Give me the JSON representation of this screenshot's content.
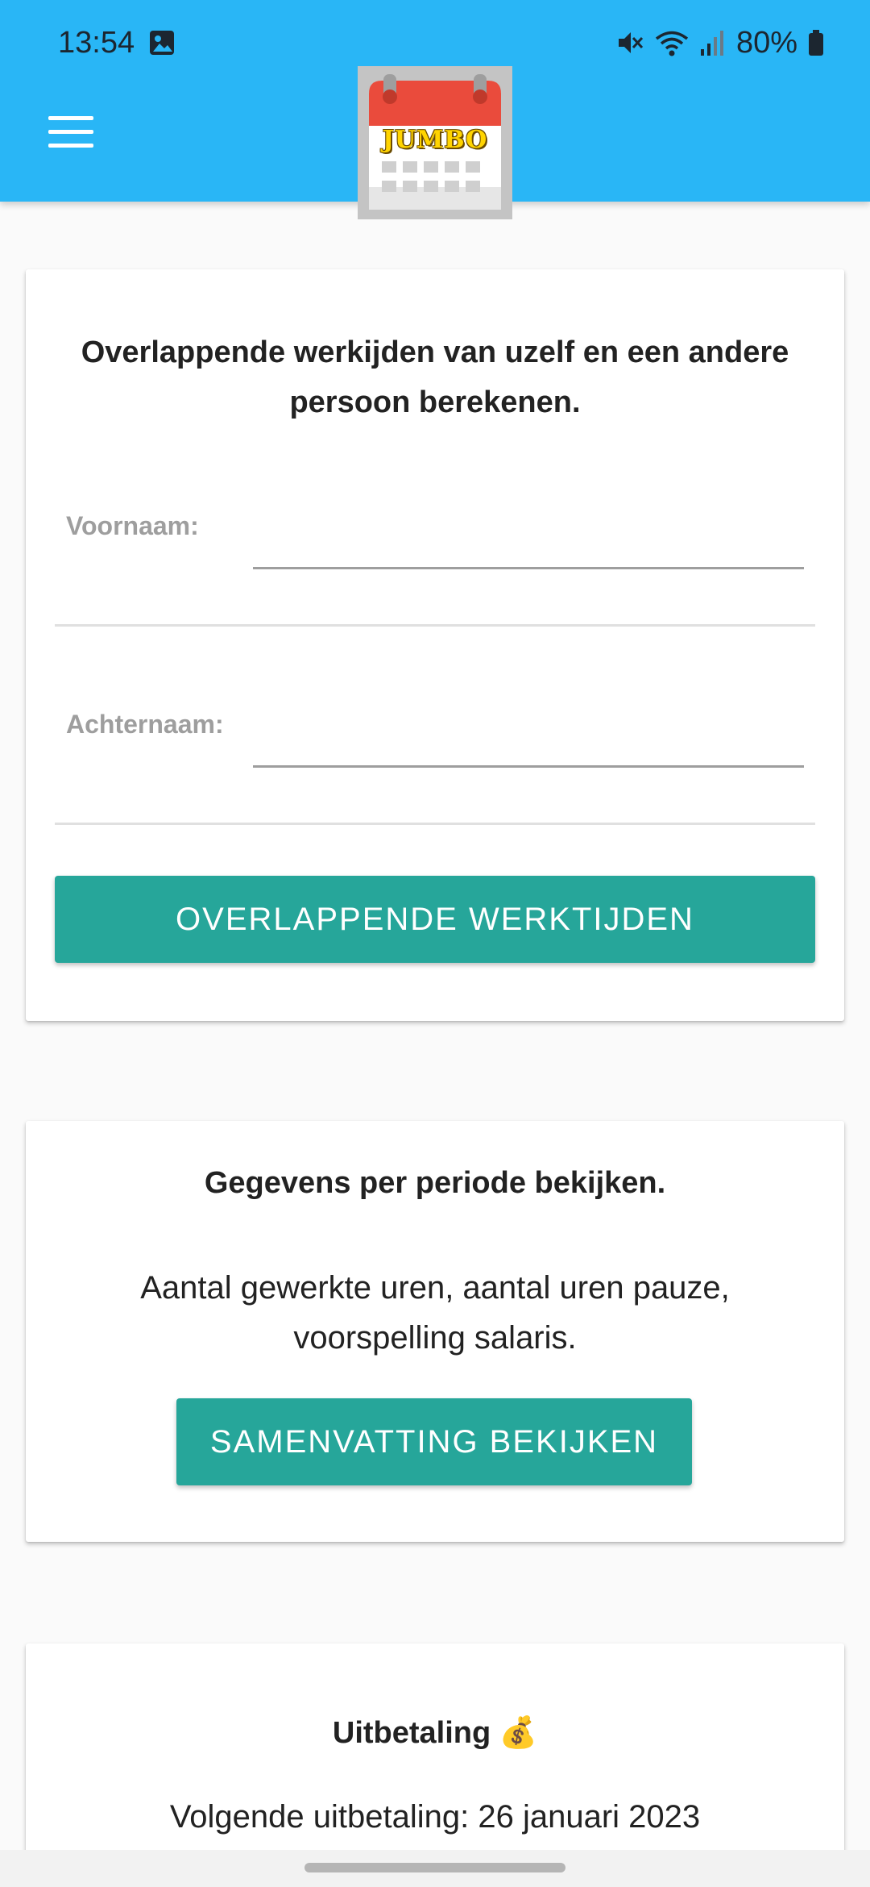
{
  "status_bar": {
    "time": "13:54",
    "battery": "80%"
  },
  "header": {
    "logo_text": "JUMBO",
    "color": "#29b6f6"
  },
  "overlap_card": {
    "title": "Overlappende werkijden van uzelf en een andere persoon berekenen.",
    "first_name_label": "Voornaam:",
    "first_name_value": "",
    "last_name_label": "Achternaam:",
    "last_name_value": "",
    "button_label": "OVERLAPPENDE WERKTIJDEN"
  },
  "summary_card": {
    "title": "Gegevens per periode bekijken.",
    "text": "Aantal gewerkte uren, aantal uren pauze, voorspelling salaris.",
    "button_label": "SAMENVATTING BEKIJKEN"
  },
  "payout_card": {
    "title": "Uitbetaling 💰",
    "text": "Volgende uitbetaling: 26 januari 2023"
  },
  "colors": {
    "accent": "#26a69a",
    "background": "#fafafa"
  }
}
